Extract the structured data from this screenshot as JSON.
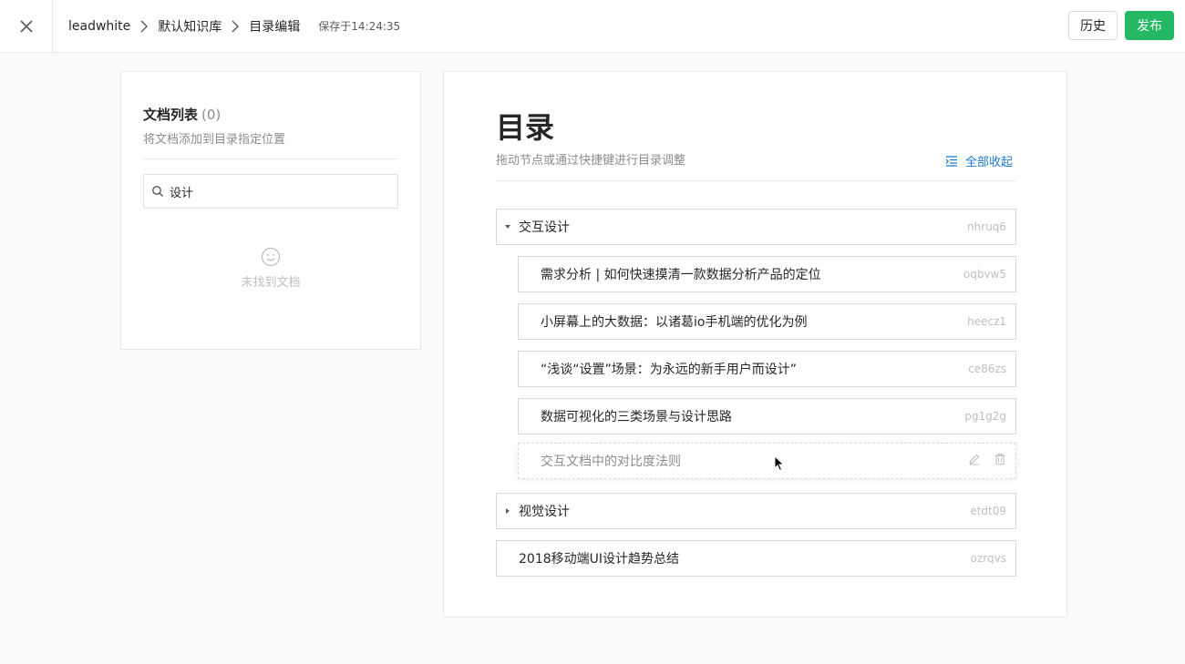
{
  "header": {
    "breadcrumb": [
      "leadwhite",
      "默认知识库",
      "目录编辑"
    ],
    "save_status": "保存于14:24:35",
    "history_label": "历史",
    "publish_label": "发布"
  },
  "doc_list": {
    "title": "文档列表",
    "count": "(0)",
    "subtitle": "将文档添加到目录指定位置",
    "search_value": "设计",
    "empty_text": "未找到文档"
  },
  "toc": {
    "title": "目录",
    "hint": "拖动节点或通过快捷键进行目录调整",
    "collapse_all_label": "全部收起",
    "nodes": [
      {
        "label": "交互设计",
        "slug": "nhruq6",
        "expanded": true
      },
      {
        "label": "需求分析 | 如何快速摸清一款数据分析产品的定位",
        "slug": "oqbvw5"
      },
      {
        "label": "小屏幕上的大数据：以诸葛io手机端的优化为例",
        "slug": "heecz1"
      },
      {
        "label": "“浅谈“设置”场景：为永远的新手用户而设计”",
        "slug": "ce86zs"
      },
      {
        "label": "数据可视化的三类场景与设计思路",
        "slug": "pg1g2g"
      },
      {
        "label": "交互文档中的对比度法则"
      },
      {
        "label": "视觉设计",
        "slug": "etdt09",
        "expanded": false
      },
      {
        "label": "2018移动端UI设计趋势总结",
        "slug": "ozrqvs"
      }
    ]
  },
  "colors": {
    "primary_green": "#25b864",
    "link_blue": "#1a7bd8",
    "border": "#d9d9d9"
  }
}
